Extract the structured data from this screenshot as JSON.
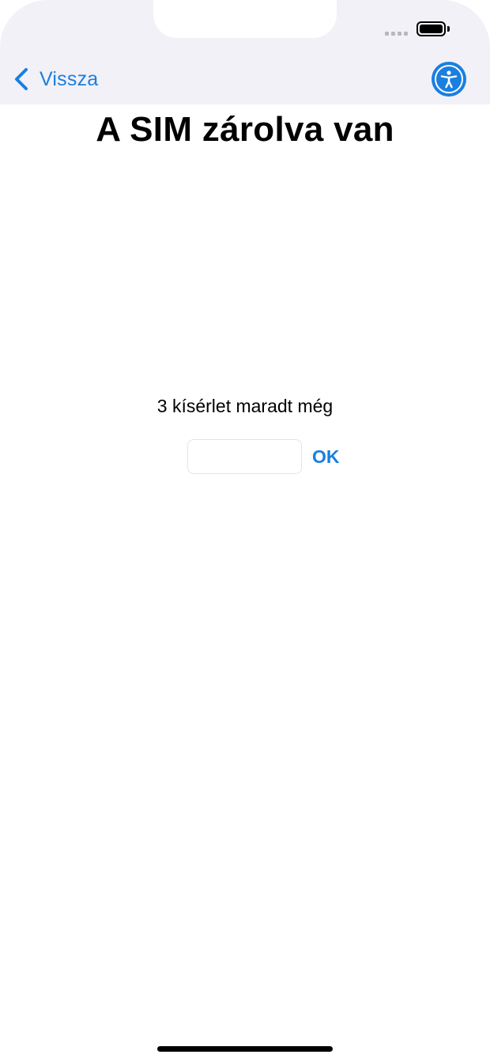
{
  "nav": {
    "back_label": "Vissza",
    "back_icon": "chevron-left-icon",
    "accessibility_icon": "accessibility-icon"
  },
  "status_bar": {
    "signal_icon": "signal-dots-icon",
    "battery_icon": "battery-full-icon",
    "battery_level": 1.0
  },
  "main": {
    "title": "A SIM zárolva van",
    "attempts_text": "3 kísérlet maradt még",
    "pin_input": {
      "value": "",
      "placeholder": ""
    },
    "ok_label": "OK"
  },
  "colors": {
    "accent": "#1a7fe0",
    "nav_background": "#f2f1f7",
    "background": "#ffffff"
  }
}
